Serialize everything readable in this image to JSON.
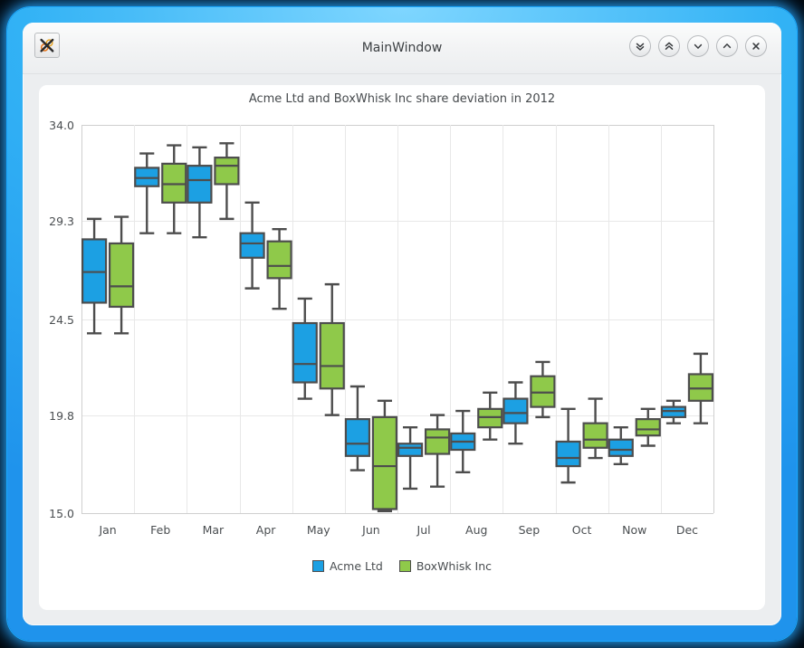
{
  "window": {
    "title": "MainWindow",
    "app_icon": "x-app-icon",
    "buttons": [
      {
        "name": "shade-all-down-button",
        "icon": "double-chevron-down-icon",
        "label": "»"
      },
      {
        "name": "shade-all-up-button",
        "icon": "double-chevron-up-icon",
        "label": "«"
      },
      {
        "name": "minimize-button",
        "icon": "chevron-down-icon",
        "label": "⌄"
      },
      {
        "name": "maximize-button",
        "icon": "chevron-up-icon",
        "label": "⌃"
      },
      {
        "name": "close-button",
        "icon": "close-x-icon",
        "label": "×"
      }
    ]
  },
  "colors": {
    "series_acme": "#1ca0e3",
    "series_boxwhisk": "#8fc94a",
    "outline": "#4d4d4d",
    "grid": "#e8e8e8",
    "axis": "#cfcfcf",
    "text": "#4a4e51",
    "frame_blue": "#32b2f5",
    "chrome_gray": "#eceef0",
    "panel_white": "#ffffff"
  },
  "chart_data": {
    "type": "box",
    "title": "Acme Ltd and BoxWhisk Inc share deviation in 2012",
    "xlabel": "",
    "ylabel": "",
    "ylim": [
      15.0,
      34.0
    ],
    "yticks": [
      "34.0",
      "29.3",
      "24.5",
      "19.8",
      "15.0"
    ],
    "ytick_values": [
      34.0,
      29.3,
      24.5,
      19.8,
      15.0
    ],
    "grid": true,
    "legend_position": "bottom",
    "categories": [
      "Jan",
      "Feb",
      "Mar",
      "Apr",
      "May",
      "Jun",
      "Jul",
      "Aug",
      "Sep",
      "Oct",
      "Now",
      "Dec"
    ],
    "series": [
      {
        "name": "Acme Ltd",
        "color": "#1ca0e3",
        "boxes": [
          {
            "category": "Jan",
            "min": 23.8,
            "q1": 25.3,
            "median": 26.8,
            "q3": 28.4,
            "max": 29.4
          },
          {
            "category": "Feb",
            "min": 28.7,
            "q1": 31.0,
            "median": 31.4,
            "q3": 31.9,
            "max": 32.6
          },
          {
            "category": "Mar",
            "min": 28.5,
            "q1": 30.2,
            "median": 31.3,
            "q3": 32.0,
            "max": 32.9
          },
          {
            "category": "Apr",
            "min": 26.0,
            "q1": 27.5,
            "median": 28.2,
            "q3": 28.7,
            "max": 30.2
          },
          {
            "category": "May",
            "min": 20.6,
            "q1": 21.4,
            "median": 22.3,
            "q3": 24.3,
            "max": 25.5
          },
          {
            "category": "Jun",
            "min": 17.1,
            "q1": 17.8,
            "median": 18.4,
            "q3": 19.6,
            "max": 21.2
          },
          {
            "category": "Jul",
            "min": 16.2,
            "q1": 17.8,
            "median": 18.2,
            "q3": 18.4,
            "max": 19.2
          },
          {
            "category": "Aug",
            "min": 17.0,
            "q1": 18.1,
            "median": 18.5,
            "q3": 18.9,
            "max": 20.0
          },
          {
            "category": "Sep",
            "min": 18.4,
            "q1": 19.4,
            "median": 19.9,
            "q3": 20.6,
            "max": 21.4
          },
          {
            "category": "Oct",
            "min": 16.5,
            "q1": 17.3,
            "median": 17.7,
            "q3": 18.5,
            "max": 20.1
          },
          {
            "category": "Now",
            "min": 17.4,
            "q1": 17.8,
            "median": 18.1,
            "q3": 18.6,
            "max": 19.2
          },
          {
            "category": "Dec",
            "min": 19.4,
            "q1": 19.7,
            "median": 20.0,
            "q3": 20.2,
            "max": 20.5
          }
        ]
      },
      {
        "name": "BoxWhisk Inc",
        "color": "#8fc94a",
        "boxes": [
          {
            "category": "Jan",
            "min": 23.8,
            "q1": 25.1,
            "median": 26.1,
            "q3": 28.2,
            "max": 29.5
          },
          {
            "category": "Feb",
            "min": 28.7,
            "q1": 30.2,
            "median": 31.1,
            "q3": 32.1,
            "max": 33.0
          },
          {
            "category": "Mar",
            "min": 29.4,
            "q1": 31.1,
            "median": 32.0,
            "q3": 32.4,
            "max": 33.1
          },
          {
            "category": "Apr",
            "min": 25.0,
            "q1": 26.5,
            "median": 27.1,
            "q3": 28.3,
            "max": 28.9
          },
          {
            "category": "May",
            "min": 19.8,
            "q1": 21.1,
            "median": 22.2,
            "q3": 24.3,
            "max": 26.2
          },
          {
            "category": "Jun",
            "min": 15.1,
            "q1": 15.2,
            "median": 17.3,
            "q3": 19.7,
            "max": 20.5
          },
          {
            "category": "Jul",
            "min": 16.3,
            "q1": 17.9,
            "median": 18.7,
            "q3": 19.1,
            "max": 19.8
          },
          {
            "category": "Aug",
            "min": 18.6,
            "q1": 19.2,
            "median": 19.7,
            "q3": 20.1,
            "max": 20.9
          },
          {
            "category": "Sep",
            "min": 19.7,
            "q1": 20.2,
            "median": 20.9,
            "q3": 21.7,
            "max": 22.4
          },
          {
            "category": "Oct",
            "min": 17.7,
            "q1": 18.2,
            "median": 18.6,
            "q3": 19.4,
            "max": 20.6
          },
          {
            "category": "Now",
            "min": 18.3,
            "q1": 18.8,
            "median": 19.1,
            "q3": 19.6,
            "max": 20.1
          },
          {
            "category": "Dec",
            "min": 19.4,
            "q1": 20.5,
            "median": 21.1,
            "q3": 21.8,
            "max": 22.8
          }
        ]
      }
    ],
    "legend": [
      {
        "label": "Acme Ltd",
        "color": "#1ca0e3"
      },
      {
        "label": "BoxWhisk Inc",
        "color": "#8fc94a"
      }
    ]
  }
}
